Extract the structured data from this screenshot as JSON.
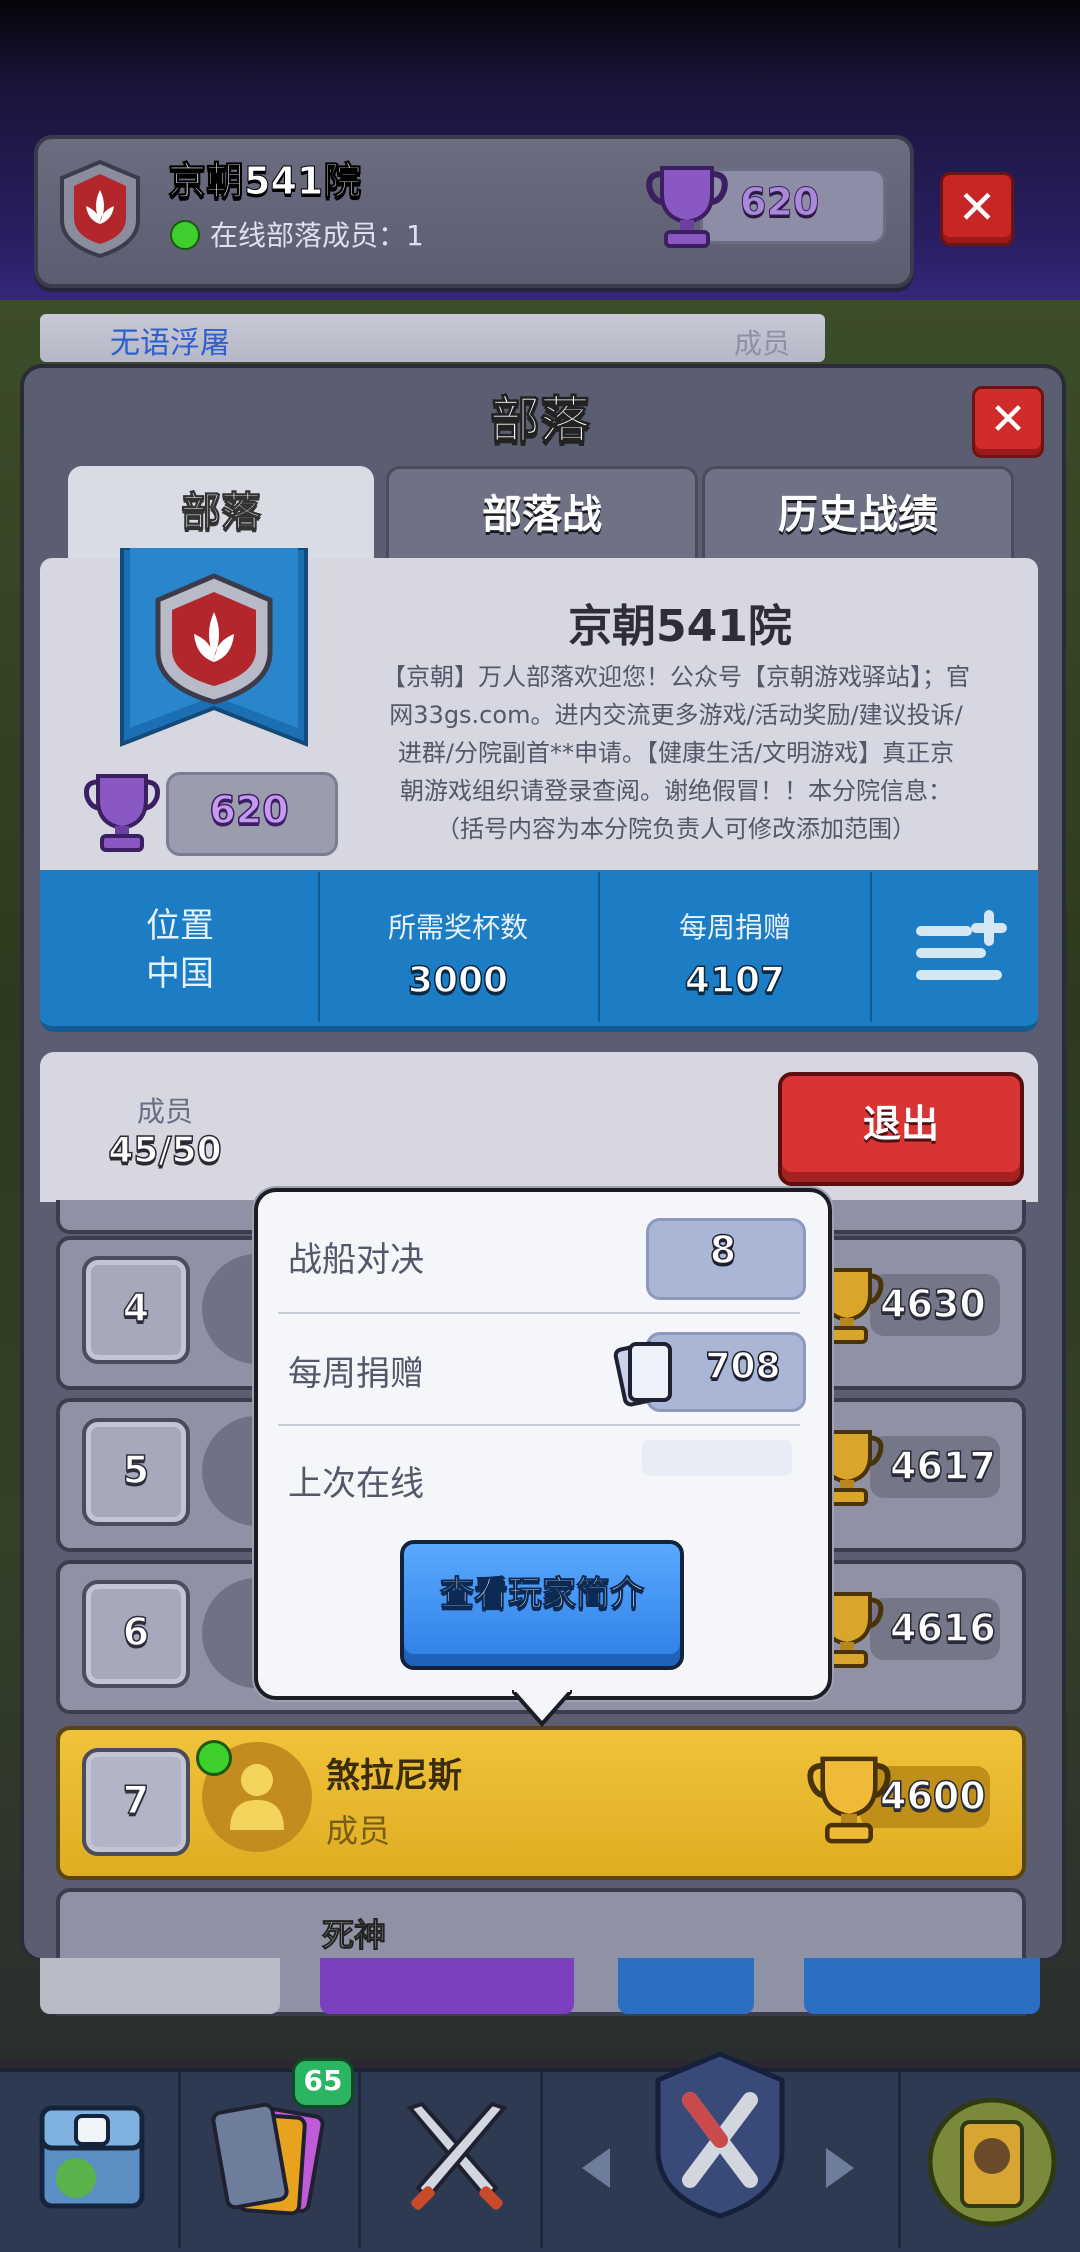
{
  "header": {
    "clan_name": "京朝541院",
    "online_text": "在线部落成员：1",
    "trophies": "620",
    "close_label": "✕"
  },
  "behind_strip": {
    "name": "无语浮屠",
    "role": "成员"
  },
  "panel": {
    "title": "部落",
    "close_label": "✕",
    "tabs": [
      {
        "label": "部落"
      },
      {
        "label": "部落战"
      },
      {
        "label": "历史战绩"
      }
    ]
  },
  "clan_info": {
    "name": "京朝541院",
    "trophies": "620",
    "description_lines": [
      "【京朝】万人部落欢迎您！公众号【京朝游戏驿站】；官",
      "网33gs.com。进内交流更多游戏/活动奖励/建议投诉/",
      "进群/分院副首**申请。【健康生活/文明游戏】真正京",
      "朝游戏组织请登录查阅。谢绝假冒！！本分院信息：",
      "（括号内容为本分院负责人可修改添加范围）"
    ]
  },
  "stats": {
    "location_label": "位置",
    "location_value": "中国",
    "required_label": "所需奖杯数",
    "required_value": "3000",
    "donation_label": "每周捐赠",
    "donation_value": "4107"
  },
  "members": {
    "label": "成员",
    "count": "45/50",
    "exit_label": "退出",
    "rows": [
      {
        "rank": "4",
        "trophies": "4630"
      },
      {
        "rank": "5",
        "trophies": "4617"
      },
      {
        "rank": "6",
        "trophies": "4616"
      },
      {
        "rank": "7",
        "name": "煞拉尼斯",
        "role": "成员",
        "trophies": "4600"
      },
      {
        "name": "死神"
      }
    ]
  },
  "popup": {
    "battle_label": "战船对决",
    "battle_value": "8",
    "donation_label": "每周捐赠",
    "donation_value": "708",
    "last_online_label": "上次在线",
    "profile_button": "查看玩家简介"
  },
  "nav": {
    "cards_badge": "65"
  },
  "colors": {
    "highlight_row": "#e8b82c",
    "stats_bar": "#1c7cc4",
    "exit_button": "#d93434",
    "profile_button": "#3a8ff0"
  }
}
